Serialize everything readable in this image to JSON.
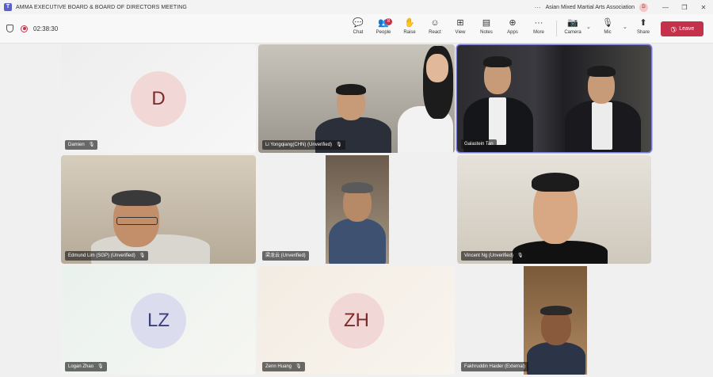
{
  "window": {
    "title": "AMMA EXECUTIVE BOARD & BOARD OF DIRECTORS MEETING",
    "org": "Asian Mixed Martial Arts Association",
    "avatar_initial": "D",
    "more": "···"
  },
  "meeting": {
    "timer": "02:38:30"
  },
  "toolbar": {
    "chat": "Chat",
    "people": "People",
    "people_count": "8",
    "raise": "Raise",
    "react": "React",
    "view": "View",
    "notes": "Notes",
    "apps": "Apps",
    "more": "More",
    "camera": "Camera",
    "mic": "Mic",
    "share": "Share",
    "leave": "Leave"
  },
  "participants": [
    {
      "name": "Damien",
      "initials": "D",
      "type": "avatar"
    },
    {
      "name": "Li Yongqiang(CHN) (Unverified)",
      "type": "video"
    },
    {
      "name": "Galastein Tan",
      "type": "video"
    },
    {
      "name": "Edmund Lim (SGP) (Unverified)",
      "type": "video"
    },
    {
      "name": "梁龙云 (Unverified)",
      "type": "video"
    },
    {
      "name": "Vincent Ng (Unverified)",
      "type": "video"
    },
    {
      "name": "Logan Zhao",
      "initials": "LZ",
      "type": "avatar"
    },
    {
      "name": "Zenn Huang",
      "initials": "ZH",
      "type": "avatar"
    },
    {
      "name": "Fakhruddin Haider (External)",
      "type": "video"
    }
  ],
  "colors": {
    "accent": "#5b5fc7",
    "leave": "#c4314b"
  }
}
